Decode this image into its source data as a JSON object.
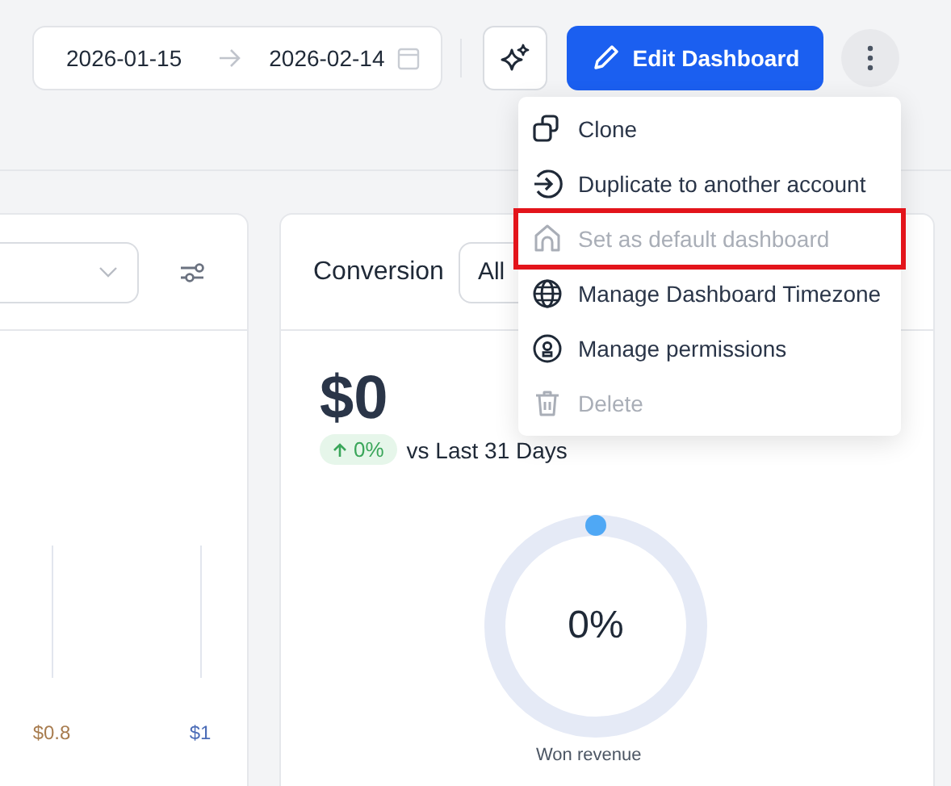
{
  "date_range": {
    "start": "2026-01-15",
    "end": "2026-02-14"
  },
  "toolbar": {
    "edit_button": "Edit Dashboard"
  },
  "menu": {
    "items": [
      {
        "label": "Clone",
        "disabled": false,
        "highlighted": false
      },
      {
        "label": "Duplicate to another account",
        "disabled": false,
        "highlighted": false
      },
      {
        "label": "Set as default dashboard",
        "disabled": true,
        "highlighted": true
      },
      {
        "label": "Manage Dashboard Timezone",
        "disabled": false,
        "highlighted": false
      },
      {
        "label": "Manage permissions",
        "disabled": false,
        "highlighted": false
      },
      {
        "label": "Delete",
        "disabled": true,
        "highlighted": false
      }
    ]
  },
  "left_card": {
    "axis_labels": [
      {
        "text": "$0.8",
        "color": "#a87c4f"
      },
      {
        "text": "$1",
        "color": "#4b6cb7"
      }
    ]
  },
  "conversion_card": {
    "title": "Conversion",
    "filter": "All",
    "value": "$0",
    "change": "0%",
    "increase": true,
    "comparison": "vs Last 31 Days",
    "gauge": {
      "level": 0,
      "label": "0%",
      "caption": "Won revenue"
    }
  }
}
